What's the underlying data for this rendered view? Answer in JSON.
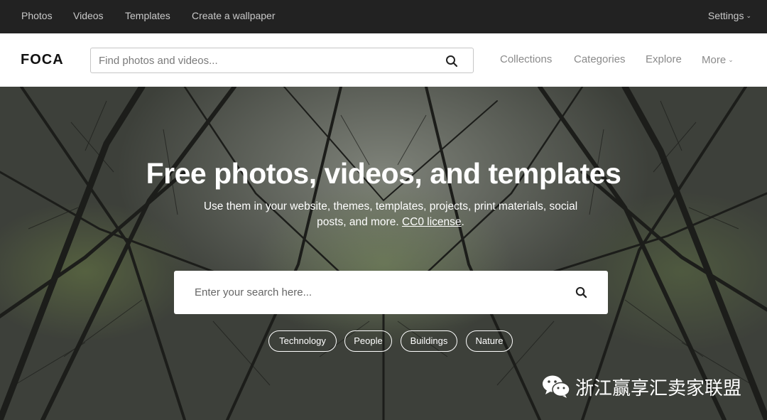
{
  "topbar": {
    "links": [
      "Photos",
      "Videos",
      "Templates",
      "Create a wallpaper"
    ],
    "settings_label": "Settings"
  },
  "header": {
    "logo": "FOCA",
    "search_placeholder": "Find photos and videos...",
    "nav": [
      "Collections",
      "Categories",
      "Explore"
    ],
    "more_label": "More"
  },
  "hero": {
    "title": "Free photos, videos, and templates",
    "subtitle": "Use them in your website, themes, templates, projects, print materials, social posts, and more.",
    "license_link": "CC0 license",
    "license_suffix": ".",
    "search_placeholder": "Enter your search here...",
    "tags": [
      "Technology",
      "People",
      "Buildings",
      "Nature"
    ]
  },
  "watermark": {
    "text": "浙江赢享汇卖家联盟"
  },
  "icons": {
    "search": "search-icon",
    "chevron": "chevron-down-icon",
    "wechat": "wechat-icon"
  },
  "colors": {
    "topbar_bg": "#222222",
    "header_bg": "#ffffff",
    "nav_text": "#8a8a8a"
  }
}
